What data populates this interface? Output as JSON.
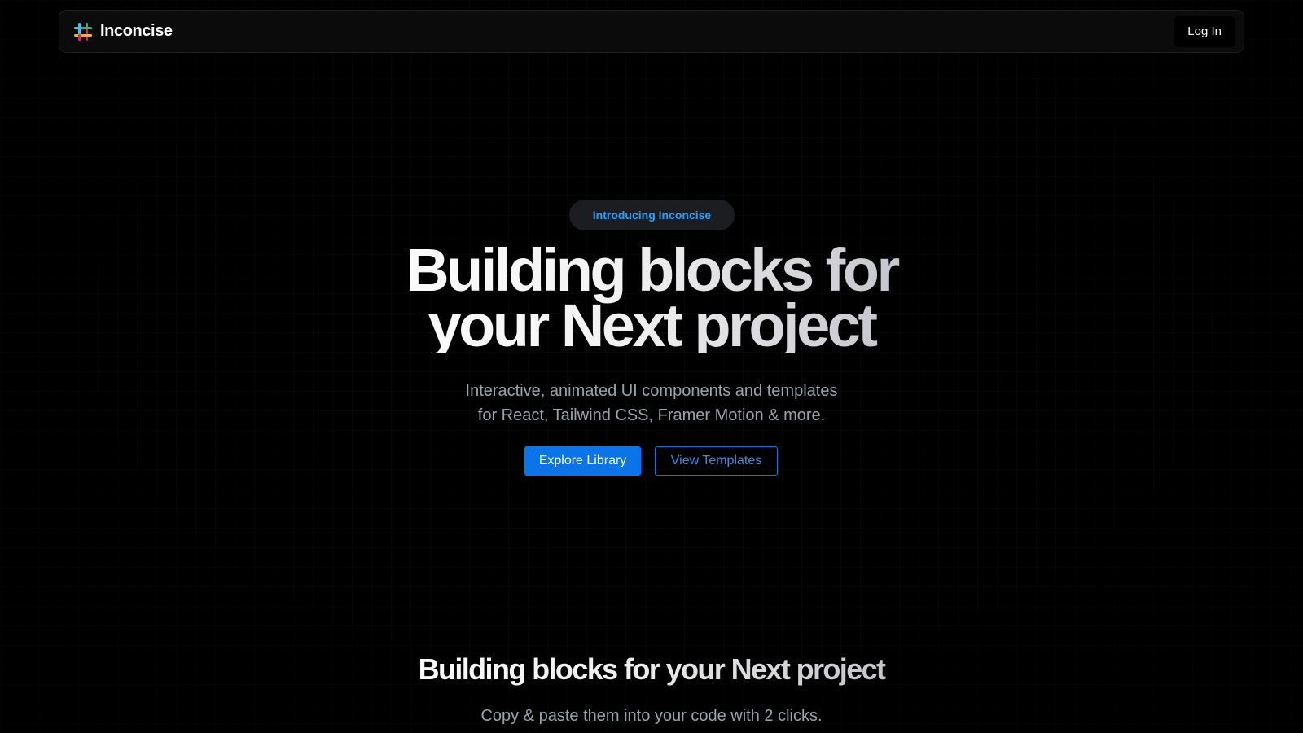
{
  "navbar": {
    "brand_name": "Inconcise",
    "logo_icon": "slack-style-hash-logo",
    "login_label": "Log In"
  },
  "hero": {
    "badge": "Introducing Inconcise",
    "title_line1": "Building blocks for",
    "title_line2": "your Next project",
    "subtitle_line1": "Interactive, animated UI components and templates",
    "subtitle_line2": "for React, Tailwind CSS, Framer Motion & more.",
    "primary_cta": "Explore Library",
    "secondary_cta": "View Templates"
  },
  "section": {
    "title": "Building blocks for your Next project",
    "subtitle": "Copy & paste them into your code with 2 clicks."
  },
  "colors": {
    "background": "#000000",
    "accent_blue": "#0b74e8",
    "badge_text": "#2f9cf0",
    "muted_text": "#9ca3ad",
    "logo_colors": [
      "#36c5f0",
      "#2eb67d",
      "#ecb22e",
      "#e01e5a"
    ]
  }
}
